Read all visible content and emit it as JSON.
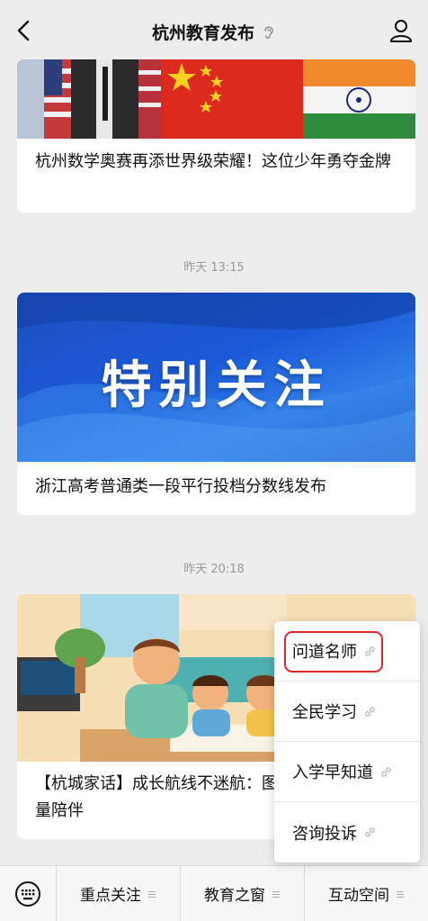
{
  "header": {
    "title": "杭州教育发布",
    "back_icon": "chevron-left-icon",
    "ear_icon": "ear-icon",
    "user_icon": "user-icon"
  },
  "articles": [
    {
      "caption": "杭州数学奥赛再添世界级荣耀！这位少年勇夺金牌"
    },
    {
      "timestamp": "昨天 13:15",
      "banner": "特别关注",
      "caption": "浙江高考普通类一段平行投档分数线发布"
    },
    {
      "timestamp": "昨天 20:18",
      "caption": "【杭城家话】成长航线不迷航：图”指引暑期高质量陪伴"
    }
  ],
  "popup": {
    "items": [
      {
        "label": "问道名师",
        "icon": "link-icon"
      },
      {
        "label": "全民学习",
        "icon": "link-icon"
      },
      {
        "label": "入学早知道",
        "icon": "link-icon"
      },
      {
        "label": "咨询投诉",
        "icon": "link-icon"
      }
    ]
  },
  "bottom_menu": {
    "keyboard_icon": "keyboard-icon",
    "tabs": [
      {
        "label": "重点关注"
      },
      {
        "label": "教育之窗"
      },
      {
        "label": "互动空间"
      }
    ]
  },
  "colors": {
    "highlight": "#e02a2a",
    "banner_blue": "#1b5ad8"
  }
}
